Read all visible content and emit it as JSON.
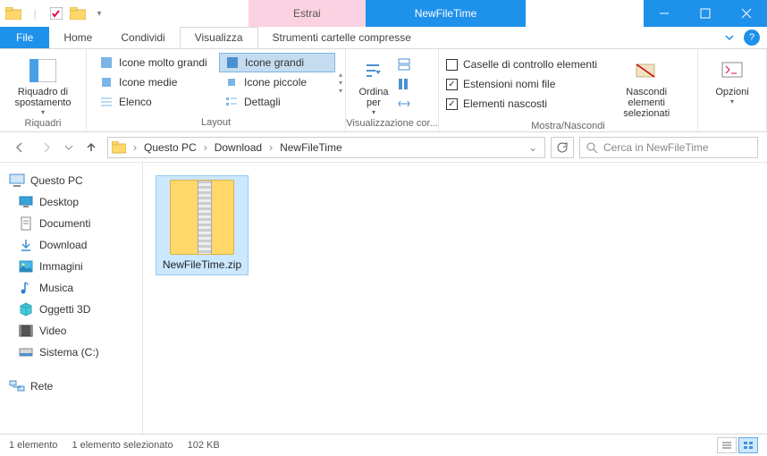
{
  "title_tabs": {
    "extract": "Estrai",
    "window_title": "NewFileTime"
  },
  "tabs": {
    "file": "File",
    "home": "Home",
    "share": "Condividi",
    "view": "Visualizza",
    "compressed": "Strumenti cartelle compresse"
  },
  "ribbon": {
    "panes": {
      "riquadri": "Riquadri",
      "layout": "Layout",
      "view": "Visualizzazione cor...",
      "show_hide": "Mostra/Nascondi"
    },
    "nav_pane": "Riquadro di spostamento",
    "layout": {
      "xl": "Icone molto grandi",
      "lg": "Icone grandi",
      "md": "Icone medie",
      "sm": "Icone piccole",
      "list": "Elenco",
      "detail": "Dettagli"
    },
    "sort": "Ordina per",
    "checks": {
      "item_check": "Caselle di controllo elementi",
      "file_ext": "Estensioni nomi file",
      "hidden": "Elementi nascosti"
    },
    "hide": "Nascondi elementi selezionati",
    "options": "Opzioni"
  },
  "breadcrumb": {
    "pc": "Questo PC",
    "dl": "Download",
    "folder": "NewFileTime"
  },
  "search_placeholder": "Cerca in NewFileTime",
  "nav": {
    "pc": "Questo PC",
    "desktop": "Desktop",
    "docs": "Documenti",
    "dl": "Download",
    "img": "Immagini",
    "music": "Musica",
    "obj3d": "Oggetti 3D",
    "video": "Video",
    "sysc": "Sistema (C:)",
    "net": "Rete"
  },
  "file": {
    "name": "NewFileTime.zip"
  },
  "status": {
    "count": "1 elemento",
    "selected": "1 elemento selezionato",
    "size": "102 KB"
  }
}
